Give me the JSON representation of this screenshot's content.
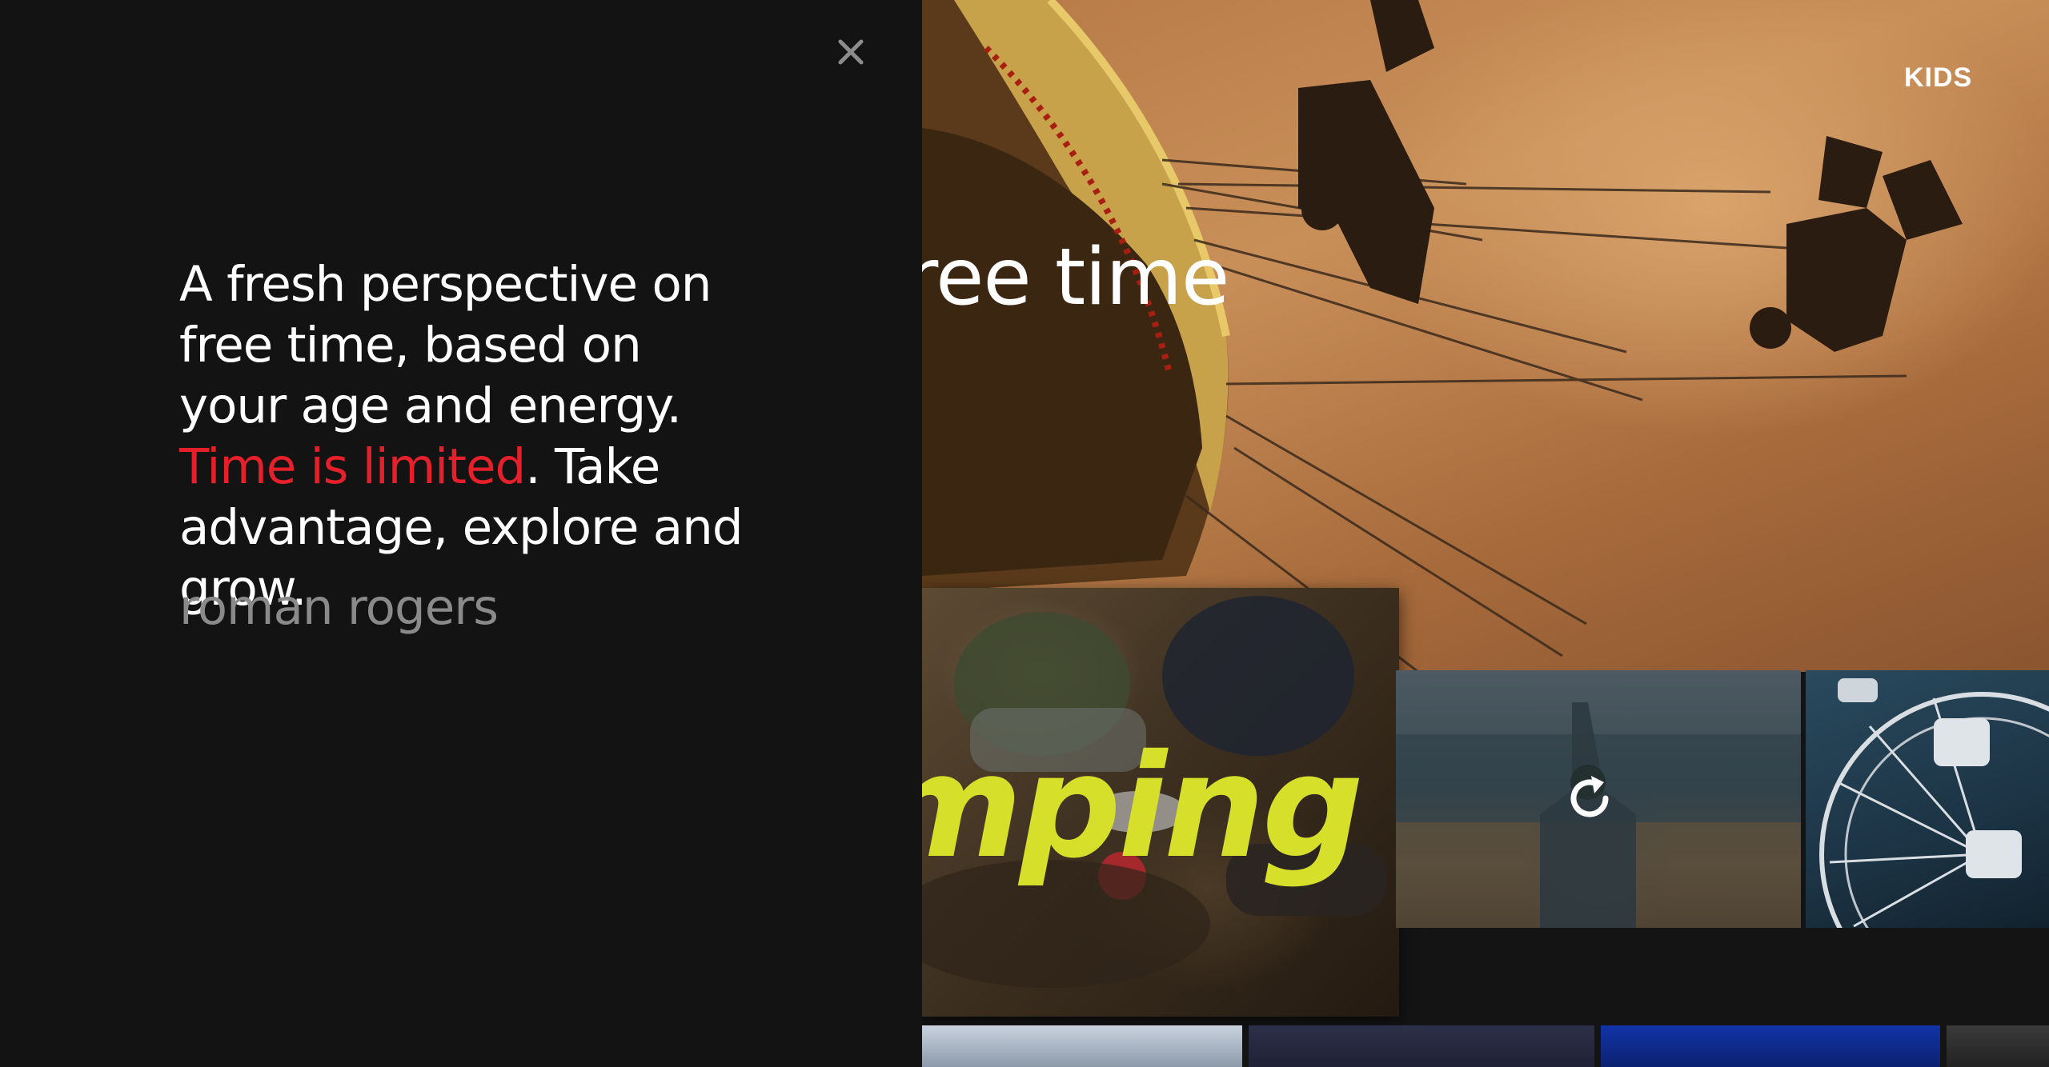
{
  "overlay": {
    "close_label": "×",
    "quote": {
      "part1": "A fresh perspective on free time, based on your age and energy. ",
      "highlight": "Time is limited",
      "part2": ". Take advantage, explore and grow."
    },
    "author": "roman rogers"
  },
  "header": {
    "kids_label": "KIDS"
  },
  "hero": {
    "title": "ree time"
  },
  "tiles": [
    {
      "label": "mping",
      "icon": ""
    },
    {
      "label": "",
      "icon": "refresh-icon"
    },
    {
      "label": "",
      "icon": ""
    }
  ],
  "colors": {
    "background": "#131313",
    "highlight": "#e5202a",
    "author": "#8a8a8a",
    "tile_label": "#d6e02a"
  }
}
